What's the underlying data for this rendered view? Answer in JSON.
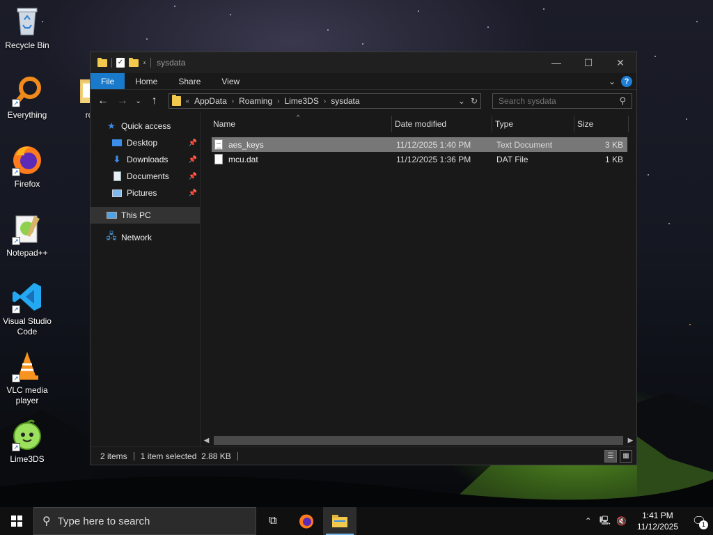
{
  "desktop": {
    "icons": [
      {
        "label": "Recycle Bin",
        "icon": "recycle-bin-icon"
      },
      {
        "label": "Everything",
        "icon": "everything-search-icon"
      },
      {
        "label": "roms",
        "icon": "folder-icon"
      },
      {
        "label": "Firefox",
        "icon": "firefox-icon"
      },
      {
        "label": "Notepad++",
        "icon": "notepad-plus-plus-icon"
      },
      {
        "label": "Visual Studio Code",
        "icon": "vscode-icon"
      },
      {
        "label": "VLC media player",
        "icon": "vlc-icon"
      },
      {
        "label": "Lime3DS",
        "icon": "lime3ds-icon"
      }
    ]
  },
  "window": {
    "title": "sysdata",
    "controls": {
      "minimize": "—",
      "maximize": "☐",
      "close": "✕"
    },
    "ribbon": {
      "file": "File",
      "home": "Home",
      "share": "Share",
      "view": "View"
    },
    "address": {
      "overflow": "«",
      "crumbs": [
        "AppData",
        "Roaming",
        "Lime3DS",
        "sysdata"
      ]
    },
    "search": {
      "placeholder": "Search sysdata"
    },
    "nav": {
      "quick_access": "Quick access",
      "desktop": "Desktop",
      "downloads": "Downloads",
      "documents": "Documents",
      "pictures": "Pictures",
      "this_pc": "This PC",
      "network": "Network"
    },
    "columns": {
      "name": "Name",
      "date": "Date modified",
      "type": "Type",
      "size": "Size"
    },
    "files": [
      {
        "name": "aes_keys",
        "date": "11/12/2025 1:40 PM",
        "type": "Text Document",
        "size": "3 KB",
        "selected": true
      },
      {
        "name": "mcu.dat",
        "date": "11/12/2025 1:36 PM",
        "type": "DAT File",
        "size": "1 KB",
        "selected": false
      }
    ],
    "status": {
      "count": "2 items",
      "selection": "1 item selected  2.88 KB"
    }
  },
  "taskbar": {
    "search_placeholder": "Type here to search",
    "time": "1:41 PM",
    "date": "11/12/2025",
    "notifications": "1"
  },
  "colors": {
    "accent": "#1979ca",
    "selection": "#777777",
    "folder": "#f2c94c"
  }
}
